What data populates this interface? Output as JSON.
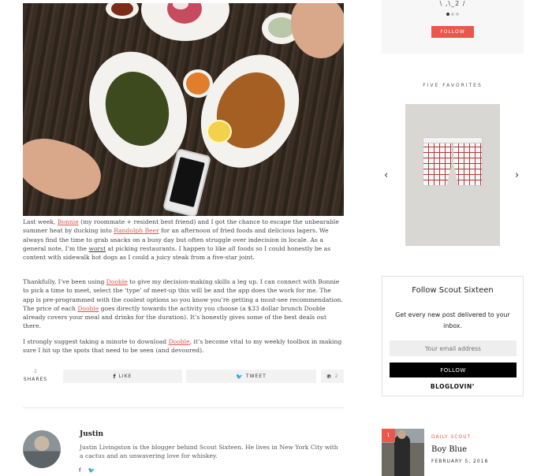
{
  "post": {
    "p1": {
      "a": "Last week, ",
      "link1": "Bonnie",
      "b": " (my roommate + resident best friend) and I got the chance to escape the unbearable summer heat by ducking into ",
      "link2": "Randolph Beer",
      "c": " for an afternoon of fried foods and delicious lagers. We always find the time to grab snacks on a busy day but often struggle over indecision in locale.  As a general note, I’m the ",
      "u1": "worst",
      "d": " at picking restaurants. I happen to like ",
      "em": "all",
      "e": " foods so I could honestly be as content with sidewalk hot dogs as I could a juicy steak from a five-star joint."
    },
    "p2": {
      "a": "Thankfully, I’ve been using ",
      "link1": "Dooble",
      "b": " to give my decision-making skills a leg up. I can connect with Bonnie to pick a time to meet, select the ‘type’ of meet-up this will be and the app does the work for me. The app is pre-programmed with the coolest options so you know you’re getting a must-see recommendation. The price of each ",
      "link2": "Dooble",
      "c": " goes directly towards the activity you choose (a $33 dollar brunch Dooble already covers your meal and drinks for the duration). It’s honestly gives some of the best deals out there."
    },
    "p3": {
      "a": "I strongly suggest taking a minute to download ",
      "link1": "Dooble",
      "b": ", it’s become vital to my weekly toolbox in making sure I hit up the spots that need to be seen (and devoured)."
    }
  },
  "share": {
    "count": "2",
    "count_label": "SHARES",
    "like": "LIKE",
    "tweet": "TWEET",
    "pin_count": "2"
  },
  "author": {
    "name": "Justin",
    "bio": "Justin Livingston is the blogger behind Scout Sixteen. He lives in New York City with a cactus and an unwavering love for whiskey.",
    "facebook_icon": "f",
    "twitter_icon": "🐦"
  },
  "sidebar": {
    "instagram": {
      "handle": "\\ ,\\_2 /",
      "follow_label": "FOLLOW"
    },
    "favorites": {
      "title": "FIVE FAVORITES",
      "prev": "‹",
      "next": "›"
    },
    "follow_widget": {
      "title": "Follow Scout Sixteen",
      "description": "Get every new post delivered to your inbox.",
      "email_placeholder": "Your email address",
      "follow_label": "FOLLOW",
      "bloglovin_label": "BLOGLOVIN’"
    },
    "recent": {
      "badge": "1",
      "category": "DAILY SCOUT",
      "title": "Boy Blue",
      "date": "FEBRUARY 5, 2018"
    }
  },
  "colors": {
    "accent": "#e9584b",
    "link": "#d9534f"
  }
}
